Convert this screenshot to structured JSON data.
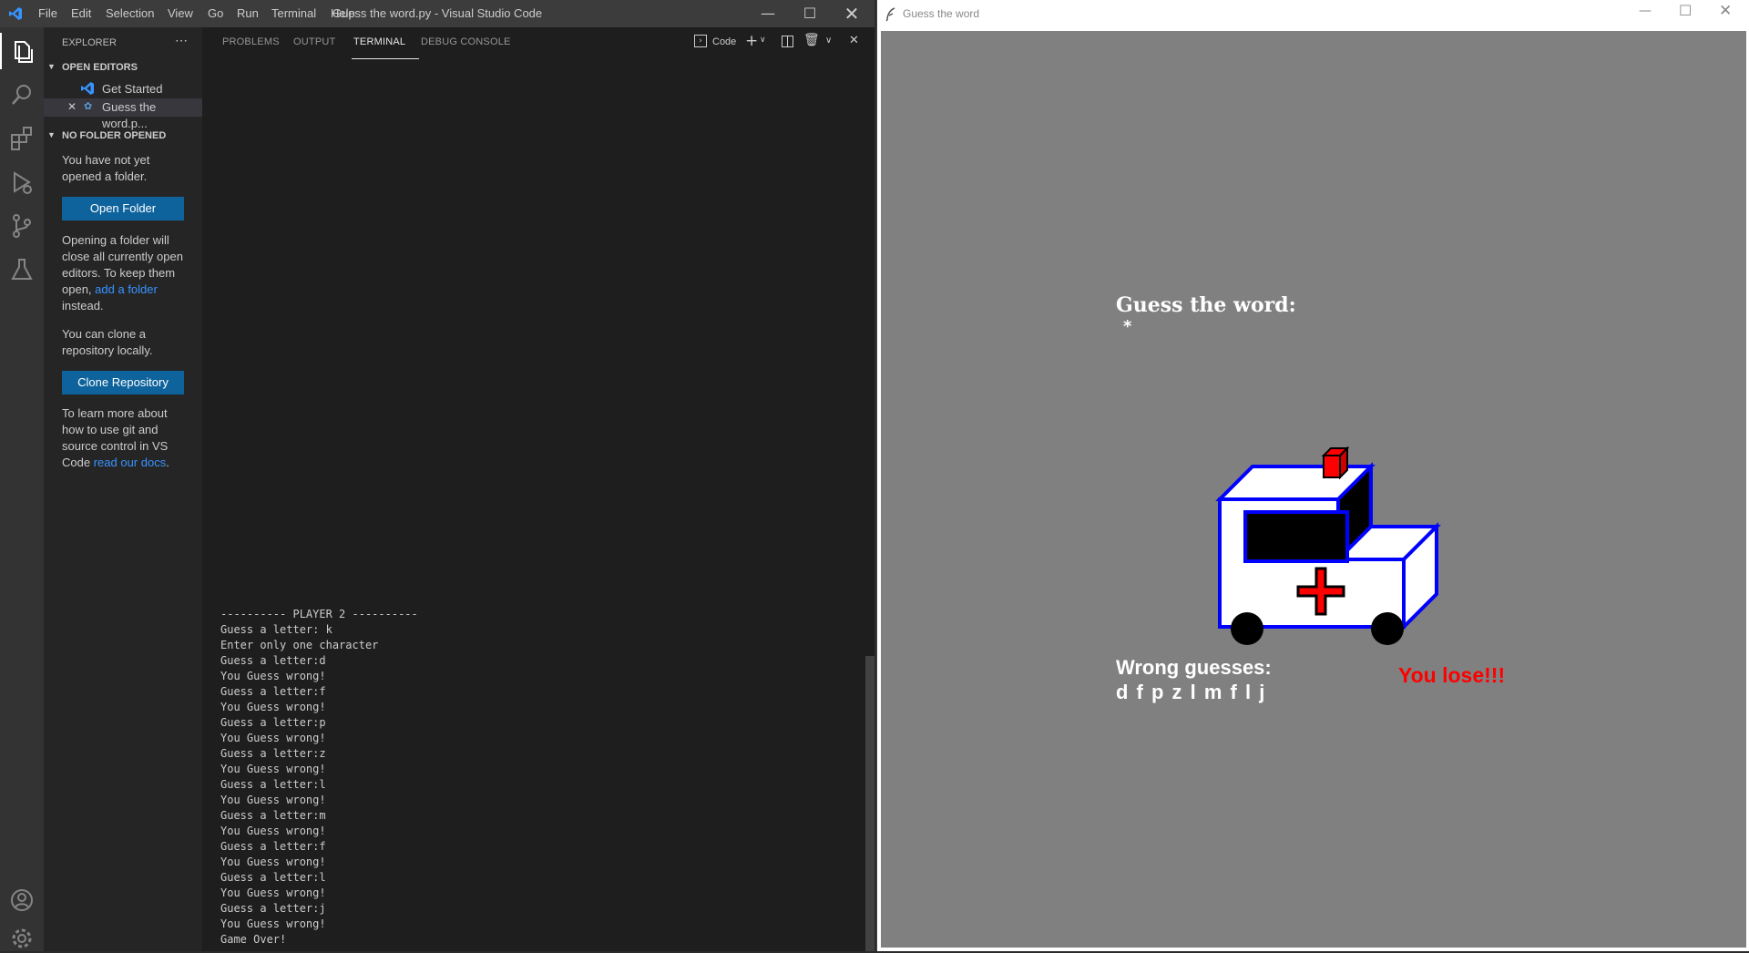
{
  "vscode": {
    "menu": [
      "File",
      "Edit",
      "Selection",
      "View",
      "Go",
      "Run",
      "Terminal",
      "Help"
    ],
    "window_title": "Guess the word.py - Visual Studio Code",
    "explorer": {
      "header": "EXPLORER",
      "open_editors_label": "OPEN EDITORS",
      "open_editors": [
        "Get Started",
        "Guess the word.p..."
      ],
      "no_folder_label": "NO FOLDER OPENED",
      "msg1": "You have not yet opened a folder.",
      "open_folder_button": "Open Folder",
      "msg2_a": "Opening a folder will close all currently open editors. To keep them open,",
      "msg2_link": "add a folder",
      "msg2_b": "instead.",
      "msg3": "You can clone a repository locally.",
      "clone_button": "Clone Repository",
      "msg4_a": "To learn more about how to use git and source control in VS Code",
      "msg4_link": "read our docs",
      "msg4_b": "."
    },
    "panel_tabs": [
      "PROBLEMS",
      "OUTPUT",
      "TERMINAL",
      "DEBUG CONSOLE"
    ],
    "active_tab": "TERMINAL",
    "terminal_label": "Code",
    "terminal_lines": [
      "---------- PLAYER 2 ----------",
      "Guess a letter: k",
      "Enter only one character",
      "Guess a letter:d",
      "You Guess wrong!",
      "Guess a letter:f",
      "You Guess wrong!",
      "Guess a letter:p",
      "You Guess wrong!",
      "Guess a letter:z",
      "You Guess wrong!",
      "Guess a letter:l",
      "You Guess wrong!",
      "Guess a letter:m",
      "You Guess wrong!",
      "Guess a letter:f",
      "You Guess wrong!",
      "Guess a letter:l",
      "You Guess wrong!",
      "Guess a letter:j",
      "You Guess wrong!",
      "Game Over!"
    ]
  },
  "game": {
    "window_title": "Guess the word",
    "guess_title": "Guess the word:",
    "guess_word": "*",
    "wrong_title": "Wrong guesses:",
    "wrong_letters": "d f p z l m f l j",
    "result": "You lose!!!"
  },
  "colors": {
    "vscode_accent": "#0e639c",
    "canvas_bg": "#808080",
    "ambulance_outline": "#0000ff",
    "cross": "#ff0000",
    "lose_text": "#ff0000"
  }
}
